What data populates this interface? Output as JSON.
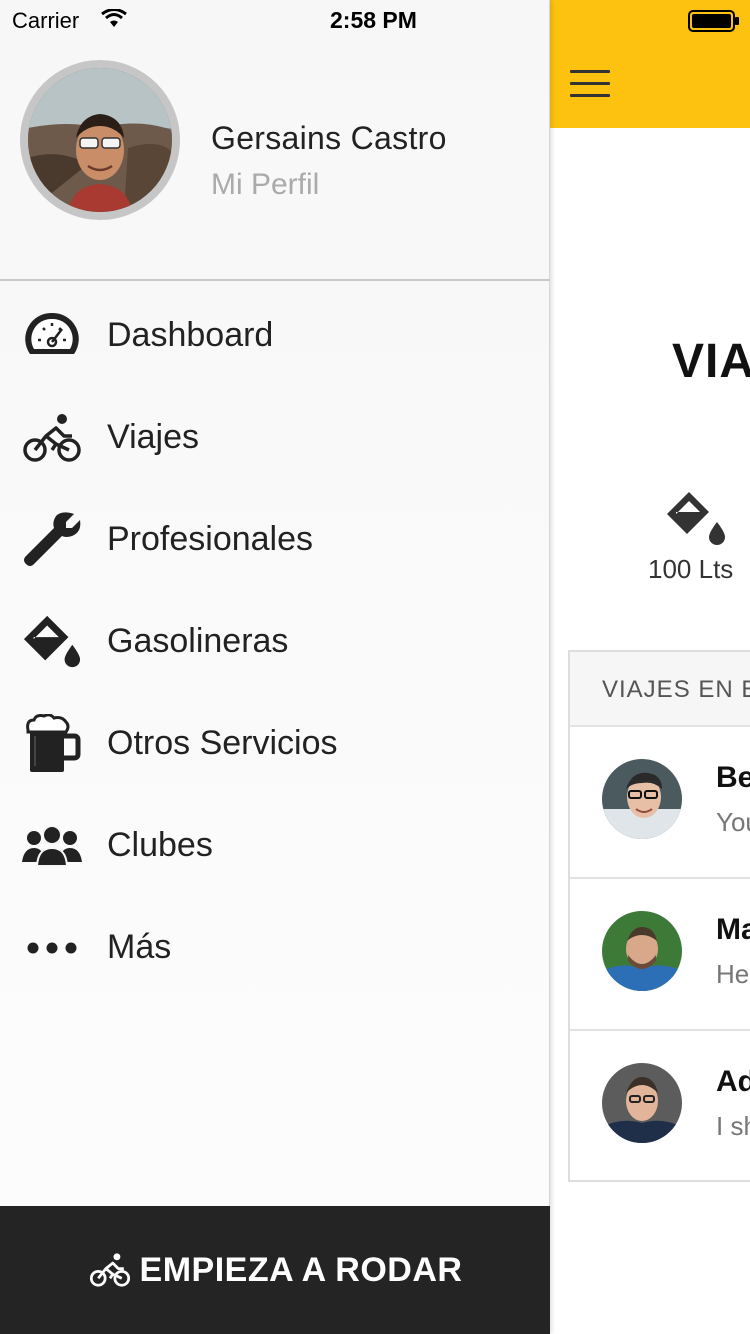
{
  "status_bar": {
    "carrier": "Carrier",
    "time": "2:58 PM"
  },
  "profile": {
    "name": "Gersains Castro",
    "link": "Mi Perfil"
  },
  "menu": {
    "items": [
      {
        "label": "Dashboard",
        "icon": "speedometer-icon"
      },
      {
        "label": "Viajes",
        "icon": "bicycle-icon"
      },
      {
        "label": "Profesionales",
        "icon": "wrench-icon"
      },
      {
        "label": "Gasolineras",
        "icon": "fuel-bucket-icon"
      },
      {
        "label": "Otros Servicios",
        "icon": "beer-mug-icon"
      },
      {
        "label": "Clubes",
        "icon": "group-icon"
      },
      {
        "label": "Más",
        "icon": "more-dots-icon"
      }
    ]
  },
  "start_button": {
    "label": "EMPIEZA A RODAR"
  },
  "main": {
    "heading": "VIA",
    "fuel": {
      "label": "100 Lts"
    },
    "trips": {
      "header": "VIAJES EN E",
      "rows": [
        {
          "name": "Be",
          "sub": "You"
        },
        {
          "name": "Ma",
          "sub": "He"
        },
        {
          "name": "Ad",
          "sub": "I sh"
        }
      ]
    }
  },
  "colors": {
    "accent": "#fdc20f",
    "drawer_bg": "#f7f7f7",
    "button_bg": "#242424"
  }
}
